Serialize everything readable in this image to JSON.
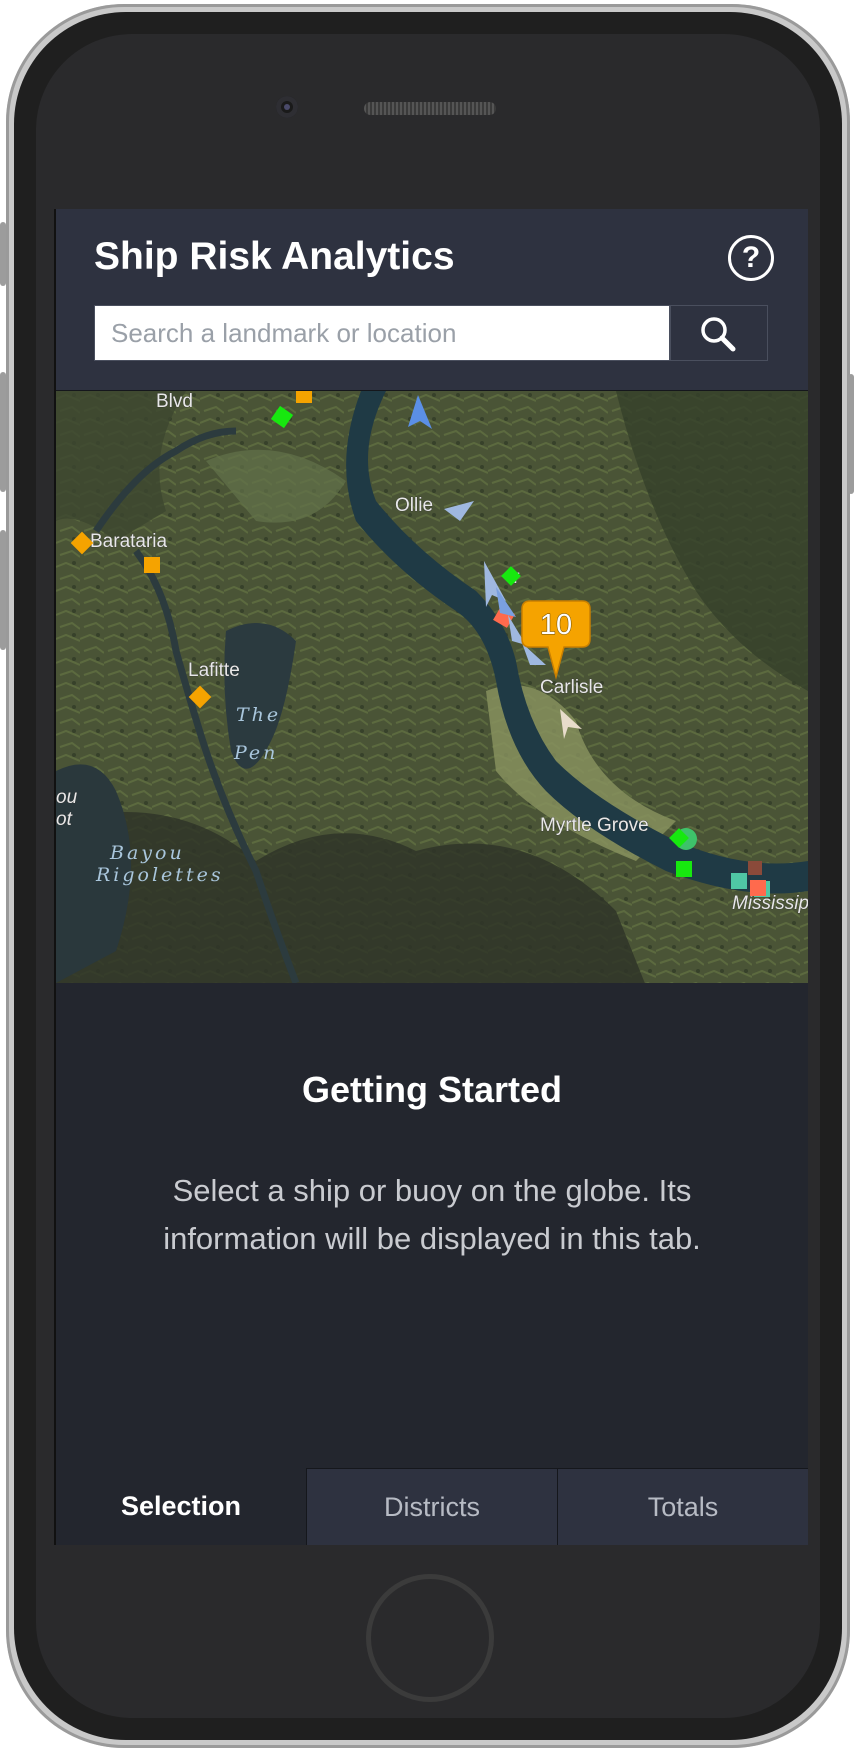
{
  "app": {
    "title": "Ship Risk Analytics",
    "help_icon": "?"
  },
  "search": {
    "placeholder": "Search a landmark or location",
    "value": ""
  },
  "map": {
    "places": [
      "Barataria",
      "Lafitte",
      "Ollie",
      "Carlisle",
      "Myrtle Grove"
    ],
    "place_fragments": [
      "Blvd",
      "ir",
      "ou",
      "ot",
      "Mississip"
    ],
    "water_names": [
      "The",
      "Pen",
      "Bayou",
      "Rigolettes"
    ],
    "cluster_count": "10",
    "colors": {
      "orange_marker": "#f5a300",
      "green_marker": "#17e80f",
      "blue_ship": "#5b8fe6",
      "light_ship": "#9fb8e0",
      "red_marker": "#ff6a4d",
      "teal_marker": "#4fc7a4"
    }
  },
  "panel": {
    "title": "Getting Started",
    "body": "Select a ship or buoy on the globe. Its information will be displayed in this tab."
  },
  "tabs": [
    {
      "label": "Selection",
      "active": true
    },
    {
      "label": "Districts",
      "active": false
    },
    {
      "label": "Totals",
      "active": false
    }
  ]
}
